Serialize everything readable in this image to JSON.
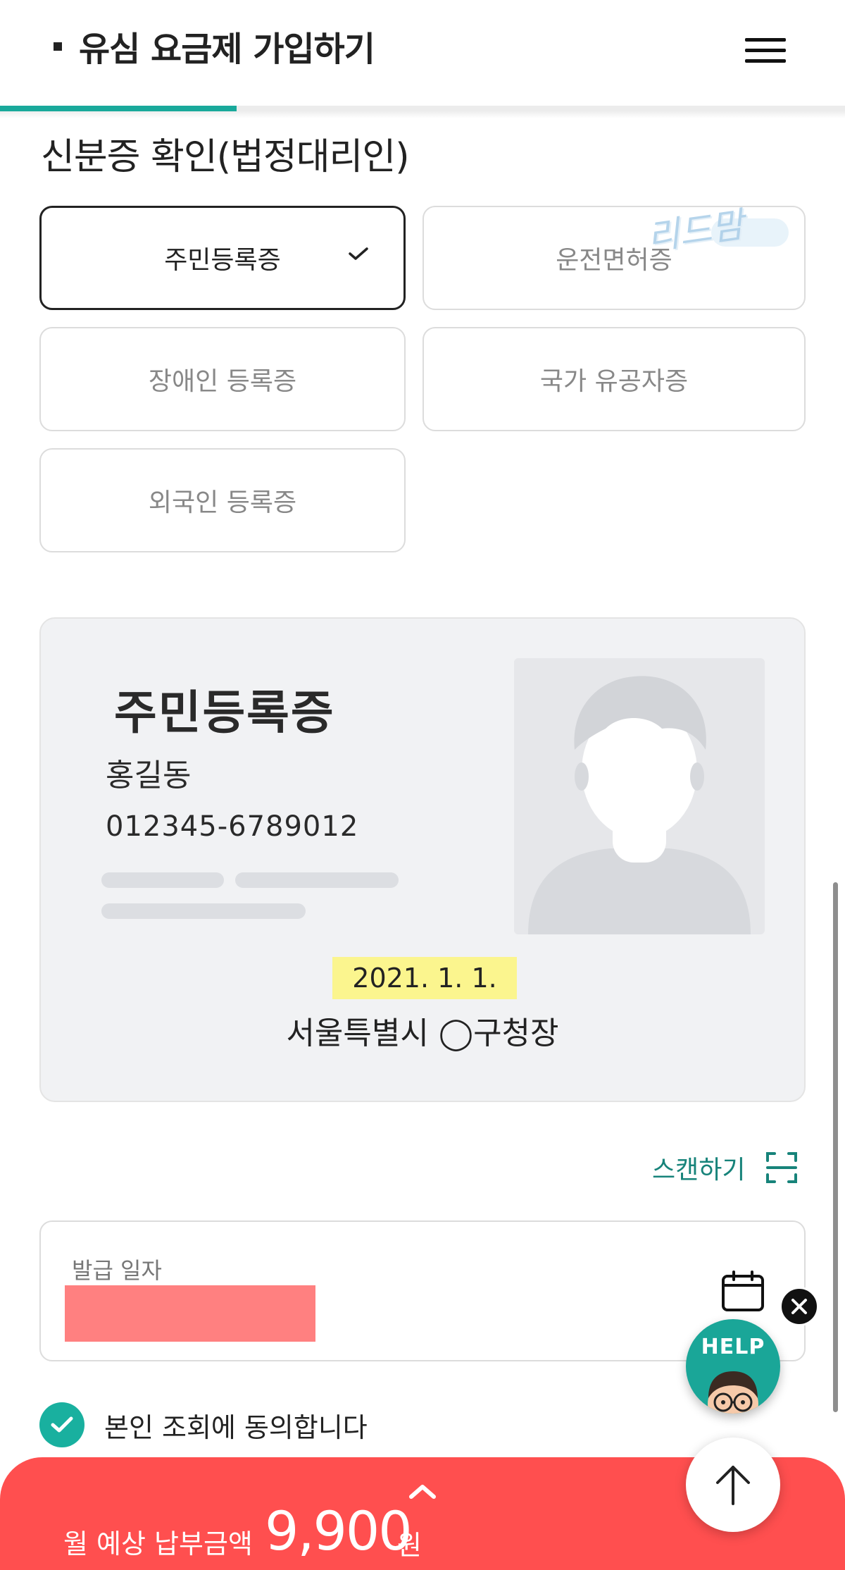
{
  "header": {
    "title": "유심 요금제 가입하기",
    "progress_percent": 28
  },
  "section_title": "신분증 확인(법정대리인)",
  "id_types": [
    {
      "label": "주민등록증",
      "selected": true
    },
    {
      "label": "운전면허증",
      "selected": false
    },
    {
      "label": "장애인 등록증",
      "selected": false
    },
    {
      "label": "국가 유공자증",
      "selected": false
    },
    {
      "label": "외국인 등록증",
      "selected": false
    }
  ],
  "watermark_text": "리드맘",
  "id_card": {
    "title": "주민등록증",
    "name": "홍길동",
    "number": "012345-6789012",
    "issue_date": "2021. 1. 1.",
    "issuer": "서울특별시 ◯구청장"
  },
  "scan": {
    "label": "스캔하기",
    "icon": "scan-frame-icon"
  },
  "date_field": {
    "label": "발급 일자",
    "value_redacted": true,
    "icon": "calendar-icon"
  },
  "agree": {
    "label": "본인 조회에 동의합니다",
    "checked": true
  },
  "help_fab": {
    "label": "HELP"
  },
  "price_bar": {
    "label": "월 예상 납부금액",
    "amount": "9,900",
    "unit": "원"
  },
  "colors": {
    "accent": "#19a99b",
    "price_bar": "#ff4f4f",
    "date_highlight": "#fbf58e",
    "redaction": "#ff8080",
    "scan_text": "#17837a"
  }
}
